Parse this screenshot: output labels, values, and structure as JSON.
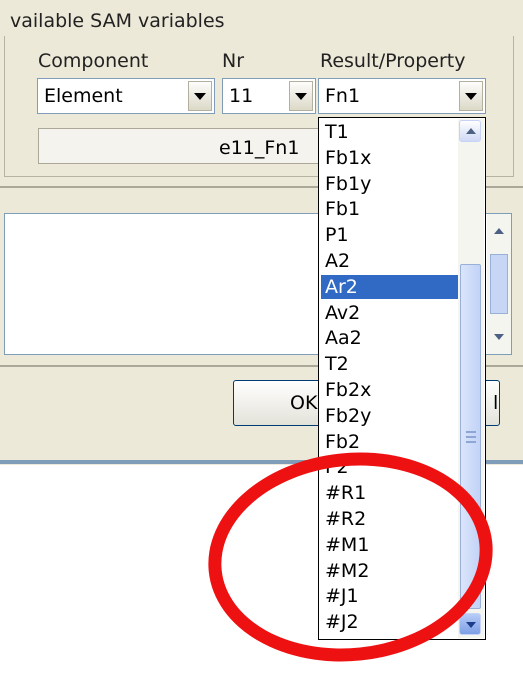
{
  "dialog": {
    "group_title": "vailable SAM variables",
    "labels": {
      "component": "Component",
      "nr": "Nr",
      "result": "Result/Property"
    },
    "component_value": "Element",
    "nr_value": "11",
    "result_value": "Fn1",
    "expression": "e11_Fn1",
    "ok_label": "OK",
    "cancel_label": "l"
  },
  "dropdown": {
    "items": [
      "T1",
      "Fb1x",
      "Fb1y",
      "Fb1",
      "P1",
      "A2",
      "Ar2",
      "Av2",
      "Aa2",
      "T2",
      "Fb2x",
      "Fb2y",
      "Fb2",
      "P2",
      "#R1",
      "#R2",
      "#M1",
      "#M2",
      "#J1",
      "#J2"
    ],
    "selected": "Ar2"
  },
  "annotation": {
    "color": "#ee1111"
  }
}
